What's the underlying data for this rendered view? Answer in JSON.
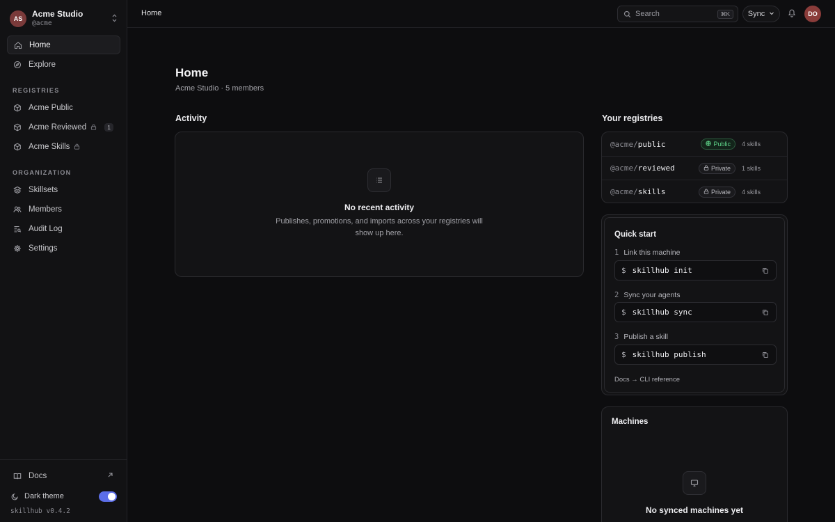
{
  "org": {
    "initials": "AS",
    "name": "Acme Studio",
    "handle": "@acme"
  },
  "nav": {
    "home": "Home",
    "explore": "Explore",
    "registries_label": "REGISTRIES",
    "registries": [
      {
        "label": "Acme Public",
        "locked": false,
        "count": ""
      },
      {
        "label": "Acme Reviewed",
        "locked": true,
        "count": "1"
      },
      {
        "label": "Acme Skills",
        "locked": true,
        "count": ""
      }
    ],
    "organization_label": "ORGANIZATION",
    "org_items": [
      "Skillsets",
      "Members",
      "Audit Log",
      "Settings"
    ]
  },
  "footer": {
    "docs": "Docs",
    "theme_label": "Dark theme",
    "theme_on": true,
    "version": "skillhub v0.4.2"
  },
  "topbar": {
    "breadcrumb": "Home",
    "search_placeholder": "Search",
    "shortcut": "⌘K",
    "sync_label": "Sync",
    "user_initials": "DO"
  },
  "page": {
    "title": "Home",
    "subtitle": "Acme Studio · 5 members"
  },
  "activity": {
    "heading": "Activity",
    "empty_title": "No recent activity",
    "empty_desc_line1": "Publishes, promotions, and imports across your registries will",
    "empty_desc_line2": "show up here."
  },
  "your_registries": {
    "heading": "Your registries",
    "items": [
      {
        "ns": "@acme/",
        "name": "public",
        "visibility": "Public",
        "skills": "4 skills"
      },
      {
        "ns": "@acme/",
        "name": "reviewed",
        "visibility": "Private",
        "skills": "1 skills"
      },
      {
        "ns": "@acme/",
        "name": "skills",
        "visibility": "Private",
        "skills": "4 skills"
      }
    ]
  },
  "quick_start": {
    "title": "Quick start",
    "steps": [
      {
        "num": "1",
        "label": "Link this machine",
        "cmd": "skillhub init"
      },
      {
        "num": "2",
        "label": "Sync your agents",
        "cmd": "skillhub sync"
      },
      {
        "num": "3",
        "label": "Publish a skill",
        "cmd": "skillhub publish"
      }
    ],
    "prompt": "$",
    "docs_link": "Docs → CLI reference"
  },
  "machines": {
    "title": "Machines",
    "empty_title": "No synced machines yet"
  },
  "colors": {
    "accent": "#5c6ee8",
    "public_green": "#5fd58a",
    "avatar_red": "#8a3c3a"
  }
}
